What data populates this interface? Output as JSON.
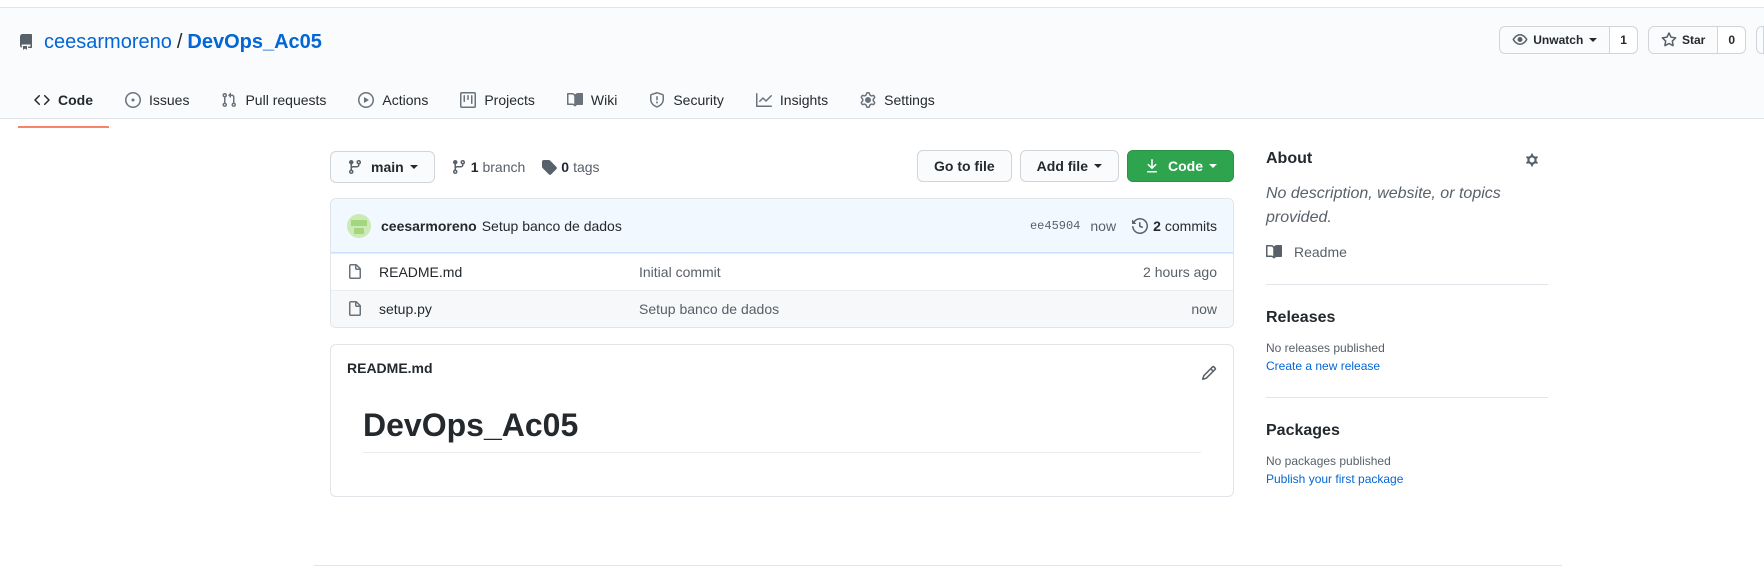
{
  "repo": {
    "owner": "ceesarmoreno",
    "separator": "/",
    "name": "DevOps_Ac05"
  },
  "head_actions": {
    "watch_label": "Unwatch",
    "watch_count": "1",
    "star_label": "Star",
    "star_count": "0"
  },
  "nav": {
    "tabs": [
      {
        "label": "Code",
        "icon": "code-icon",
        "active": true
      },
      {
        "label": "Issues",
        "icon": "issue-icon"
      },
      {
        "label": "Pull requests",
        "icon": "pull-request-icon"
      },
      {
        "label": "Actions",
        "icon": "play-icon"
      },
      {
        "label": "Projects",
        "icon": "project-icon"
      },
      {
        "label": "Wiki",
        "icon": "book-icon"
      },
      {
        "label": "Security",
        "icon": "shield-icon"
      },
      {
        "label": "Insights",
        "icon": "graph-icon"
      },
      {
        "label": "Settings",
        "icon": "gear-icon"
      }
    ]
  },
  "toolbar": {
    "branch": "main",
    "branch_count": "1",
    "branch_word": "branch",
    "tag_count": "0",
    "tag_word": "tags",
    "go_to_file": "Go to file",
    "add_file": "Add file",
    "code": "Code"
  },
  "commit": {
    "author": "ceesarmoreno",
    "message": "Setup banco de dados",
    "sha": "ee45904",
    "time": "now",
    "count": "2",
    "count_word": "commits"
  },
  "files": [
    {
      "name": "README.md",
      "message": "Initial commit",
      "age": "2 hours ago"
    },
    {
      "name": "setup.py",
      "message": "Setup banco de dados",
      "age": "now"
    }
  ],
  "readme": {
    "filename": "README.md",
    "heading": "DevOps_Ac05"
  },
  "sidebar": {
    "about_title": "About",
    "about_desc": "No description, website, or topics provided.",
    "readme_link": "Readme",
    "releases_title": "Releases",
    "releases_empty": "No releases published",
    "releases_link": "Create a new release",
    "packages_title": "Packages",
    "packages_empty": "No packages published",
    "packages_link": "Publish your first package"
  },
  "colors": {
    "link": "#0366d6",
    "green_button": "#2ea44f",
    "active_tab_underline": "#f9826c",
    "commit_bar_bg": "#f1f8ff"
  }
}
